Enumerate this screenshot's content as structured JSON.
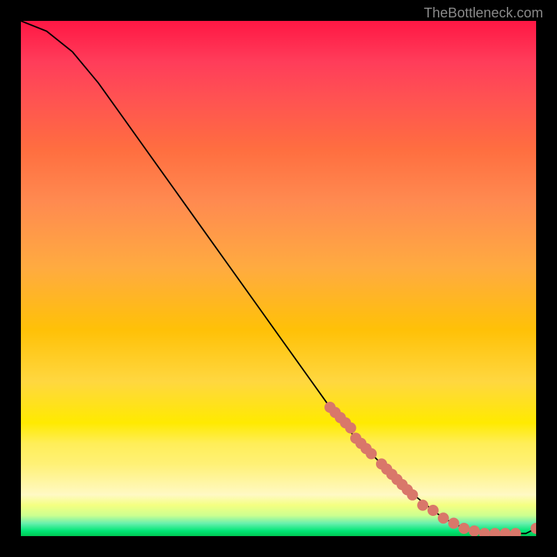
{
  "watermark": "TheBottleneck.com",
  "chart_data": {
    "type": "line",
    "title": "",
    "xlabel": "",
    "ylabel": "",
    "xlim": [
      0,
      100
    ],
    "ylim": [
      0,
      100
    ],
    "curve": {
      "x": [
        0,
        5,
        10,
        15,
        20,
        25,
        30,
        35,
        40,
        45,
        50,
        55,
        60,
        65,
        70,
        75,
        80,
        82,
        85,
        88,
        90,
        92,
        94,
        96,
        98,
        100
      ],
      "y": [
        100,
        98,
        94,
        88,
        81,
        74,
        67,
        60,
        53,
        46,
        39,
        32,
        25,
        19,
        14,
        9,
        5,
        3.5,
        2,
        1,
        0.5,
        0.5,
        0.5,
        0.5,
        0.5,
        1.5
      ]
    },
    "markers": {
      "x": [
        60,
        61,
        62,
        63,
        64,
        65,
        66,
        67,
        68,
        70,
        71,
        72,
        73,
        74,
        75,
        76,
        78,
        80,
        82,
        84,
        86,
        88,
        90,
        92,
        94,
        96,
        100
      ],
      "y": [
        25,
        24,
        23,
        22,
        21,
        19,
        18,
        17,
        16,
        14,
        13,
        12,
        11,
        10,
        9,
        8,
        6,
        5,
        3.5,
        2.5,
        1.5,
        1,
        0.5,
        0.5,
        0.5,
        0.5,
        1.5
      ],
      "color": "#d9776a",
      "size": 8
    }
  }
}
